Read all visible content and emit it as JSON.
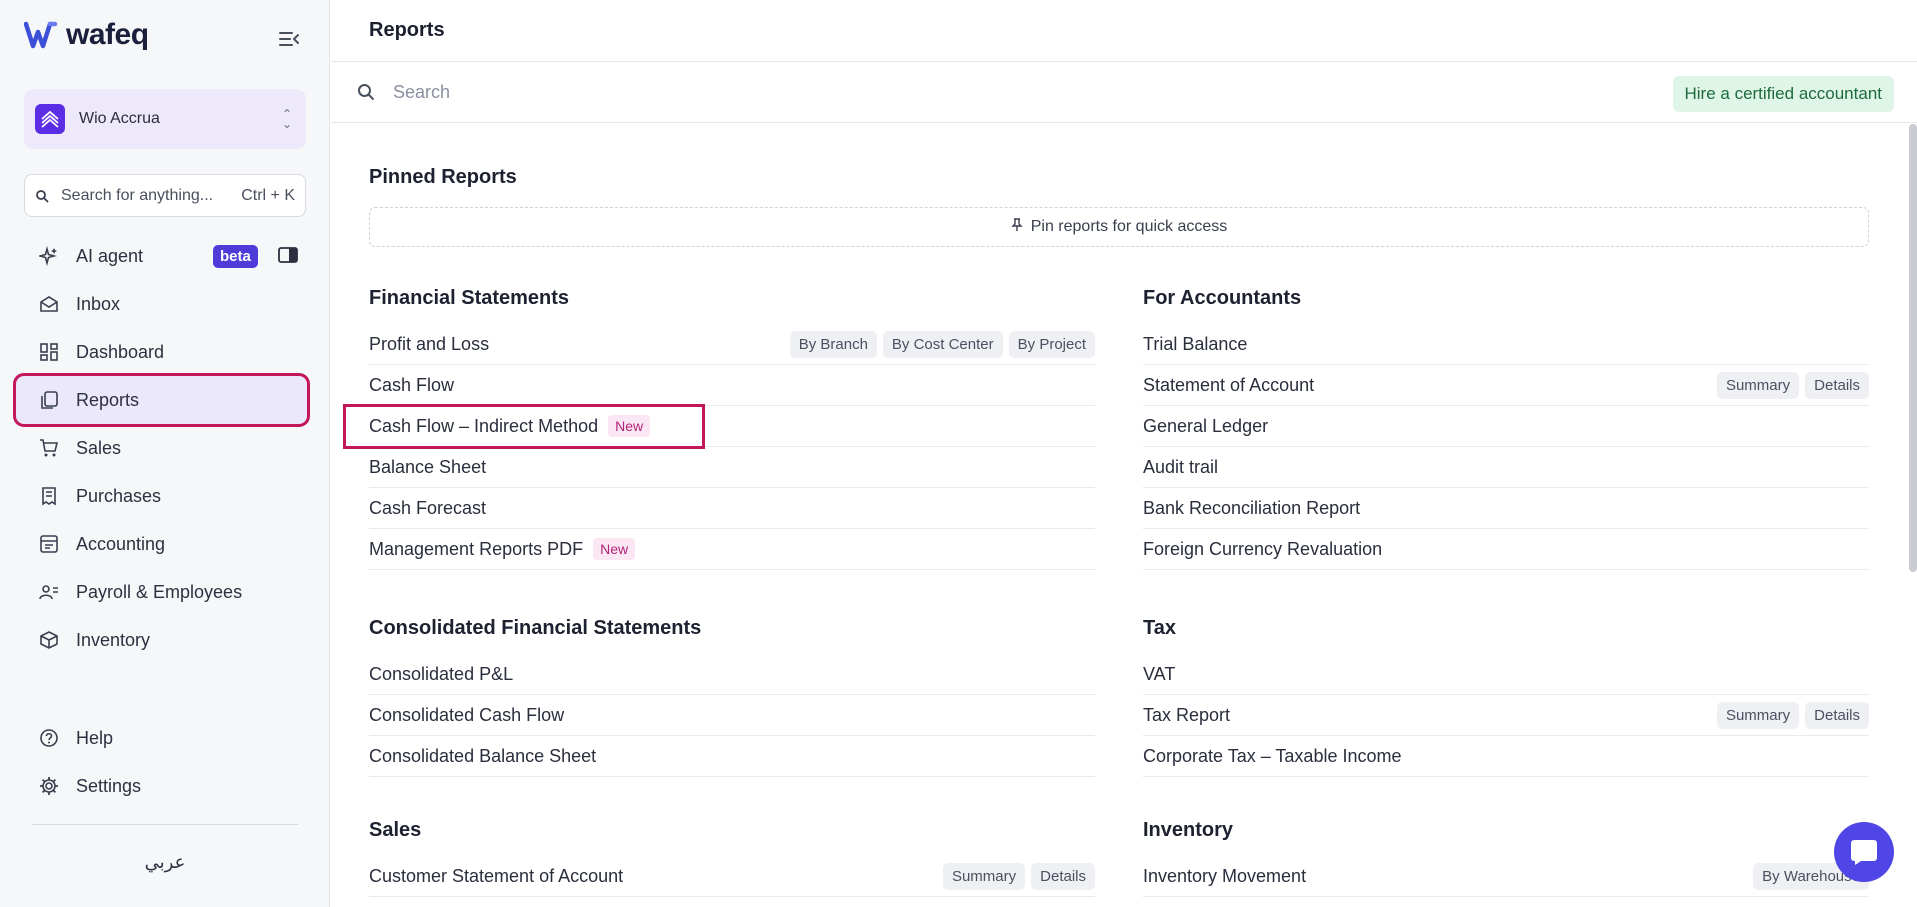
{
  "app": {
    "name": "wafeq"
  },
  "org": {
    "name": "Wio Accrua"
  },
  "global_search": {
    "placeholder": "Search for anything...",
    "shortcut": "Ctrl + K"
  },
  "nav": {
    "items": [
      {
        "label": "AI agent",
        "badge": "beta"
      },
      {
        "label": "Inbox"
      },
      {
        "label": "Dashboard"
      },
      {
        "label": "Reports"
      },
      {
        "label": "Sales"
      },
      {
        "label": "Purchases"
      },
      {
        "label": "Accounting"
      },
      {
        "label": "Payroll & Employees"
      },
      {
        "label": "Inventory"
      }
    ],
    "bottom": [
      {
        "label": "Help"
      },
      {
        "label": "Settings"
      }
    ],
    "language": "عربي"
  },
  "header": {
    "title": "Reports"
  },
  "search": {
    "placeholder": "Search"
  },
  "hire_button": "Hire a certified accountant",
  "pinned": {
    "title": "Pinned Reports",
    "empty_text": "Pin reports for quick access"
  },
  "sections": {
    "financial": {
      "title": "Financial Statements",
      "rows": [
        {
          "name": "Profit and Loss",
          "chips": [
            "By Branch",
            "By Cost Center",
            "By Project"
          ]
        },
        {
          "name": "Cash Flow"
        },
        {
          "name": "Cash Flow – Indirect Method",
          "tag": "New"
        },
        {
          "name": "Balance Sheet"
        },
        {
          "name": "Cash Forecast"
        },
        {
          "name": "Management Reports PDF",
          "tag": "New"
        }
      ]
    },
    "accountants": {
      "title": "For Accountants",
      "rows": [
        {
          "name": "Trial Balance"
        },
        {
          "name": "Statement of Account",
          "chips": [
            "Summary",
            "Details"
          ]
        },
        {
          "name": "General Ledger"
        },
        {
          "name": "Audit trail"
        },
        {
          "name": "Bank Reconciliation Report"
        },
        {
          "name": "Foreign Currency Revaluation"
        }
      ]
    },
    "consolidated": {
      "title": "Consolidated Financial Statements",
      "rows": [
        {
          "name": "Consolidated P&L"
        },
        {
          "name": "Consolidated Cash Flow"
        },
        {
          "name": "Consolidated Balance Sheet"
        }
      ]
    },
    "tax": {
      "title": "Tax",
      "rows": [
        {
          "name": "VAT"
        },
        {
          "name": "Tax Report",
          "chips": [
            "Summary",
            "Details"
          ]
        },
        {
          "name": "Corporate Tax – Taxable Income"
        }
      ]
    },
    "sales": {
      "title": "Sales",
      "rows": [
        {
          "name": "Customer Statement of Account",
          "chips": [
            "Summary",
            "Details"
          ]
        }
      ]
    },
    "inventory": {
      "title": "Inventory",
      "rows": [
        {
          "name": "Inventory Movement",
          "chips": [
            "By Warehouse"
          ]
        }
      ]
    }
  }
}
